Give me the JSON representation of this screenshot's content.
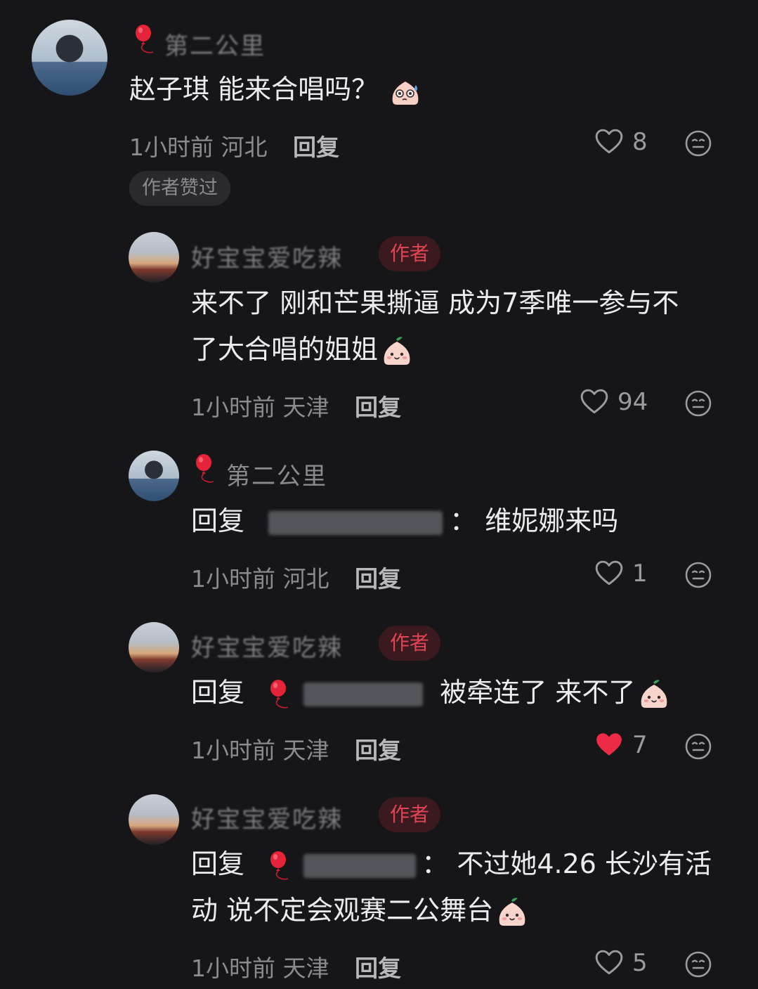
{
  "comments": [
    {
      "name": "第二公里",
      "text": "赵子琪 能来合唱吗？",
      "time": "1小时前",
      "location": "河北",
      "reply": "回复",
      "likes": "8",
      "liked": false,
      "pill": "作者赞过"
    },
    {
      "name": "好宝宝爱吃辣",
      "author_badge": "作者",
      "text_line1": "来不了 刚和芒果撕逼  成为7季唯一参与不",
      "text_line2": "了大合唱的姐姐",
      "time": "1小时前",
      "location": "天津",
      "reply": "回复",
      "likes": "94",
      "liked": false
    },
    {
      "name": "第二公里",
      "text_prefix": "回复",
      "text_body": "维妮娜来吗",
      "time": "1小时前",
      "location": "河北",
      "reply": "回复",
      "likes": "1",
      "liked": false
    },
    {
      "name": "好宝宝爱吃辣",
      "author_badge": "作者",
      "text_prefix": "回复",
      "text_body": "被牵连了 来不了",
      "time": "1小时前",
      "location": "天津",
      "reply": "回复",
      "likes": "7",
      "liked": true
    },
    {
      "name": "好宝宝爱吃辣",
      "author_badge": "作者",
      "text_prefix": "回复",
      "text_line1_body": "不过她4.26 长沙有活",
      "text_line2": "动 说不定会观赛二公舞台",
      "time": "1小时前",
      "location": "天津",
      "reply": "回复",
      "likes": "5",
      "liked": false
    }
  ],
  "colors": {
    "background": "#161618",
    "author_badge": "#e24456",
    "liked_heart": "#ee2b47"
  },
  "icons": [
    "balloon-icon",
    "heart-icon",
    "emoji-reaction-icon",
    "search-icon",
    "face-emoji-icon"
  ]
}
